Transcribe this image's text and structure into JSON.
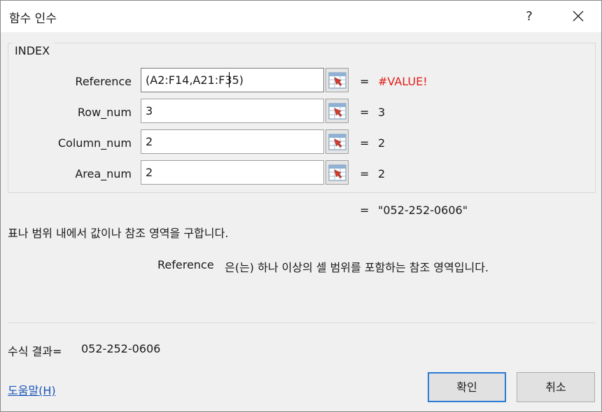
{
  "window": {
    "title": "함수 인수",
    "help_glyph": "?"
  },
  "function": {
    "name": "INDEX",
    "args": [
      {
        "label": "Reference",
        "value": "(A2:F14,A21:F35)",
        "result": "#VALUE!"
      },
      {
        "label": "Row_num",
        "value": "3",
        "result": "3"
      },
      {
        "label": "Column_num",
        "value": "2",
        "result": "2"
      },
      {
        "label": "Area_num",
        "value": "2",
        "result": "2"
      }
    ],
    "equals": "=",
    "overall_result": "\"052-252-0606\"",
    "description": "표나 범위 내에서 값이나 참조 영역을 구합니다.",
    "arg_desc_name": "Reference",
    "arg_desc_text": "은(는) 하나 이상의 셀 범위를 포함하는 참조 영역입니다."
  },
  "footer": {
    "formula_result_label": "수식 결과=",
    "formula_result_value": "052-252-0606",
    "help_link": "도움말(H)",
    "ok_label": "확인",
    "cancel_label": "취소"
  },
  "colors": {
    "error": "#e0201b",
    "link": "#1a56b8",
    "default_button_border": "#2a7ad6"
  },
  "icons": {
    "range_select": "range-select-icon",
    "close": "close-icon"
  }
}
